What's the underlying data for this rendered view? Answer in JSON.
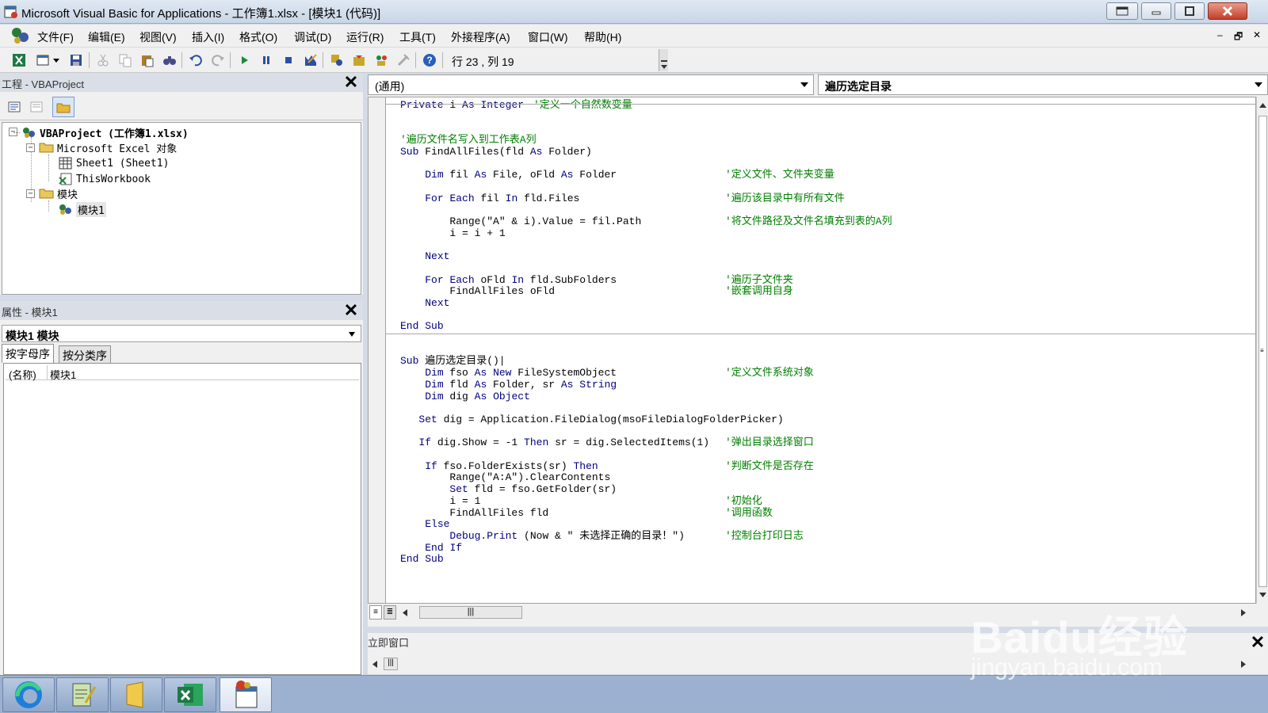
{
  "window": {
    "title": "Microsoft Visual Basic for Applications - 工作簿1.xlsx - [模块1 (代码)]"
  },
  "menu": {
    "items": [
      "文件(F)",
      "编辑(E)",
      "视图(V)",
      "插入(I)",
      "格式(O)",
      "调试(D)",
      "运行(R)",
      "工具(T)",
      "外接程序(A)",
      "窗口(W)",
      "帮助(H)"
    ],
    "mdi_buttons": [
      "‒",
      "🗗",
      "✕"
    ]
  },
  "toolbar": {
    "cursor_status": "行 23 , 列 19"
  },
  "project_panel": {
    "title": "工程 - VBAProject",
    "tree": [
      {
        "label": "VBAProject (工作簿1.xlsx)",
        "level": 0
      },
      {
        "label": "Microsoft Excel 对象",
        "level": 1
      },
      {
        "label": "Sheet1 (Sheet1)",
        "level": 2
      },
      {
        "label": "ThisWorkbook",
        "level": 2
      },
      {
        "label": "模块",
        "level": 1
      },
      {
        "label": "模块1",
        "level": 2
      }
    ]
  },
  "properties_panel": {
    "title": "属性 - 模块1",
    "object_combo": "模块1 模块",
    "tabs": [
      "按字母序",
      "按分类序"
    ],
    "rows": [
      {
        "key": "(名称)",
        "value": "模块1"
      }
    ]
  },
  "code_window": {
    "object_combo": "(通用)",
    "procedure_combo": "遍历选定目录",
    "lines": [
      "Private i As Integer",
      "",
      "",
      "'遍历文件名写入到工作表A列",
      "Sub FindAllFiles(fld As Folder)",
      "",
      "    Dim fil As File, oFld As Folder",
      "",
      "    For Each fil In fld.Files",
      "",
      "        Range(\"A\" & i).Value = fil.Path",
      "        i = i + 1",
      "",
      "    Next",
      "",
      "    For Each oFld In fld.SubFolders",
      "        FindAllFiles oFld",
      "    Next",
      "",
      "End Sub",
      "",
      "",
      "Sub 遍历选定目录()|",
      "    Dim fso As New FileSystemObject",
      "    Dim fld As Folder, sr As String",
      "    Dim dig As Object",
      "",
      "   Set dig = Application.FileDialog(msoFileDialogFolderPicker)",
      "",
      "   If dig.Show = -1 Then sr = dig.SelectedItems(1)",
      "",
      "    If fso.FolderExists(sr) Then",
      "        Range(\"A:A\").ClearContents",
      "        Set fld = fso.GetFolder(sr)",
      "        i = 1",
      "        FindAllFiles fld",
      "    Else",
      "        Debug.Print (Now & \" 未选择正确的目录！\")",
      "    End If",
      "End Sub"
    ],
    "comments": {
      "c0": "'定义一个自然数变量",
      "c6": "'定义文件、文件夹变量",
      "c8": "'遍历该目录中有所有文件",
      "c10": "'将文件路径及文件名填充到表的A列",
      "c15": "'遍历子文件夹",
      "c16": "'嵌套调用自身",
      "c23": "'定义文件系统对象",
      "c29": "'弹出目录选择窗口",
      "c31": "'判断文件是否存在",
      "c34": "'初始化",
      "c35": "'调用函数",
      "c37": "'控制台打印日志"
    }
  },
  "immediate_window": {
    "title": "立即窗口"
  },
  "watermark": {
    "text": "Baidu经验",
    "url": "jingyan.baidu.com"
  },
  "colors": {
    "keyword": "#00007f",
    "comment": "#007f00",
    "panel_bg": "#f0f0f0",
    "taskbar": "#9cb1cf"
  }
}
